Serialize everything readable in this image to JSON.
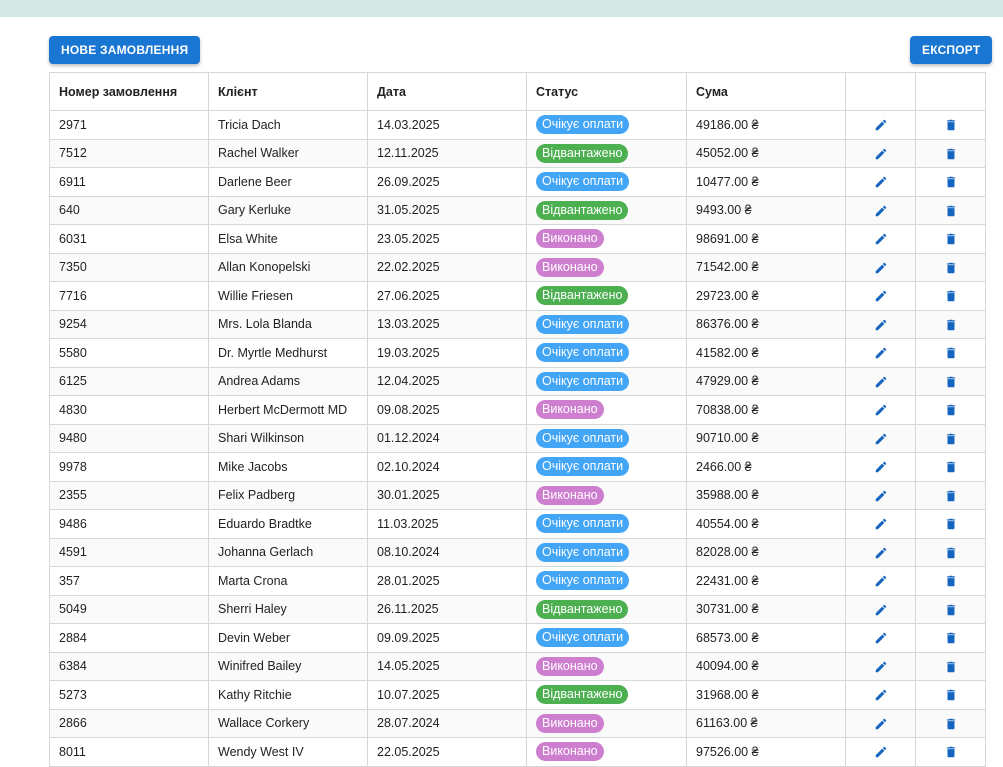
{
  "toolbar": {
    "new_order_label": "НОВЕ ЗАМОВЛЕННЯ",
    "export_label": "ЕКСПОРТ"
  },
  "table": {
    "headers": [
      "Номер замовлення",
      "Клієнт",
      "Дата",
      "Статус",
      "Сума",
      "",
      ""
    ],
    "rows": [
      {
        "id": "2971",
        "client": "Tricia Dach",
        "date": "14.03.2025",
        "status": "Очікує оплати",
        "amount": "49186.00 ₴"
      },
      {
        "id": "7512",
        "client": "Rachel Walker",
        "date": "12.11.2025",
        "status": "Відвантажено",
        "amount": "45052.00 ₴"
      },
      {
        "id": "6911",
        "client": "Darlene Beer",
        "date": "26.09.2025",
        "status": "Очікує оплати",
        "amount": "10477.00 ₴"
      },
      {
        "id": "640",
        "client": "Gary Kerluke",
        "date": "31.05.2025",
        "status": "Відвантажено",
        "amount": "9493.00 ₴"
      },
      {
        "id": "6031",
        "client": "Elsa White",
        "date": "23.05.2025",
        "status": "Виконано",
        "amount": "98691.00 ₴"
      },
      {
        "id": "7350",
        "client": "Allan Konopelski",
        "date": "22.02.2025",
        "status": "Виконано",
        "amount": "71542.00 ₴"
      },
      {
        "id": "7716",
        "client": "Willie Friesen",
        "date": "27.06.2025",
        "status": "Відвантажено",
        "amount": "29723.00 ₴"
      },
      {
        "id": "9254",
        "client": "Mrs. Lola Blanda",
        "date": "13.03.2025",
        "status": "Очікує оплати",
        "amount": "86376.00 ₴"
      },
      {
        "id": "5580",
        "client": "Dr. Myrtle Medhurst",
        "date": "19.03.2025",
        "status": "Очікує оплати",
        "amount": "41582.00 ₴"
      },
      {
        "id": "6125",
        "client": "Andrea Adams",
        "date": "12.04.2025",
        "status": "Очікує оплати",
        "amount": "47929.00 ₴"
      },
      {
        "id": "4830",
        "client": "Herbert McDermott MD",
        "date": "09.08.2025",
        "status": "Виконано",
        "amount": "70838.00 ₴"
      },
      {
        "id": "9480",
        "client": "Shari Wilkinson",
        "date": "01.12.2024",
        "status": "Очікує оплати",
        "amount": "90710.00 ₴"
      },
      {
        "id": "9978",
        "client": "Mike Jacobs",
        "date": "02.10.2024",
        "status": "Очікує оплати",
        "amount": "2466.00 ₴"
      },
      {
        "id": "2355",
        "client": "Felix Padberg",
        "date": "30.01.2025",
        "status": "Виконано",
        "amount": "35988.00 ₴"
      },
      {
        "id": "9486",
        "client": "Eduardo Bradtke",
        "date": "11.03.2025",
        "status": "Очікує оплати",
        "amount": "40554.00 ₴"
      },
      {
        "id": "4591",
        "client": "Johanna Gerlach",
        "date": "08.10.2024",
        "status": "Очікує оплати",
        "amount": "82028.00 ₴"
      },
      {
        "id": "357",
        "client": "Marta Crona",
        "date": "28.01.2025",
        "status": "Очікує оплати",
        "amount": "22431.00 ₴"
      },
      {
        "id": "5049",
        "client": "Sherri Haley",
        "date": "26.11.2025",
        "status": "Відвантажено",
        "amount": "30731.00 ₴"
      },
      {
        "id": "2884",
        "client": "Devin Weber",
        "date": "09.09.2025",
        "status": "Очікує оплати",
        "amount": "68573.00 ₴"
      },
      {
        "id": "6384",
        "client": "Winifred Bailey",
        "date": "14.05.2025",
        "status": "Виконано",
        "amount": "40094.00 ₴"
      },
      {
        "id": "5273",
        "client": "Kathy Ritchie",
        "date": "10.07.2025",
        "status": "Відвантажено",
        "amount": "31968.00 ₴"
      },
      {
        "id": "2866",
        "client": "Wallace Corkery",
        "date": "28.07.2024",
        "status": "Виконано",
        "amount": "61163.00 ₴"
      },
      {
        "id": "8011",
        "client": "Wendy West IV",
        "date": "22.05.2025",
        "status": "Виконано",
        "amount": "97526.00 ₴"
      }
    ]
  },
  "status_colors": {
    "Очікує оплати": "#42a5f5",
    "Відвантажено": "#4caf50",
    "Виконано": "#ce7ecf"
  },
  "colors": {
    "accent": "#1976d2",
    "top_strip": "#d6e8e6",
    "grid": "#d4d8d8"
  },
  "icons": {
    "edit": "pencil-icon",
    "delete": "trash-icon"
  }
}
